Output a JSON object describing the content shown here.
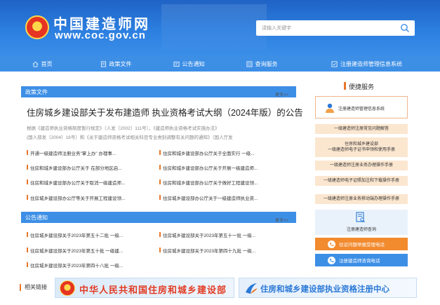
{
  "header": {
    "title": "中国建造师网",
    "url": "www.coc.gov.cn",
    "search_placeholder": "请输入关键字"
  },
  "nav": {
    "items": [
      {
        "label": "首页",
        "icon": "home-icon"
      },
      {
        "label": "政策文件",
        "icon": "document-icon"
      },
      {
        "label": "公告通知",
        "icon": "notice-icon"
      },
      {
        "label": "查询服务",
        "icon": "query-icon"
      },
      {
        "label": "注册建造师管理信息系统",
        "icon": "system-icon"
      }
    ]
  },
  "policy": {
    "section_title": "政策文件",
    "more": "更多>>",
    "headline": "住房城乡建设部关于发布建造师 执业资格考试大纲（2024年版）的公告",
    "summary_line1": "根据《建造师执业资格制度暂行规定》（人发〔2002〕111号），《建造师执业资格考试实施办法》",
    "summary_line2": "(国人部发〔2004〕16号）和《关于建造师资格考试相关科目专业类别调整有关问题的通知》（国人厅发",
    "items": [
      "开通一级建造师注册业务\"掌上办\" 办理事...",
      "住房和城乡建设部办公厅关于全面实行 一级...",
      "住房和城乡建设部办公厅关于 在部分地区启...",
      "住房和城乡建设部办公厅关于开展一级建造师...",
      "住房和城乡建设部办公厅关于取消一级建造师...",
      "住房和城乡建设部办公厅关于做好工程建设领...",
      "住房城乡建设部办公厅等关于开展工程建设领...",
      "住房城乡建设部办公厅关于一级建造师执业资..."
    ]
  },
  "notices": {
    "section_title": "公告通知",
    "more": "更多>>",
    "items": [
      "住房城乡建设部关于2023年第五十二批 一级...",
      "住房城乡建设部关于2023年第五十一批 一级...",
      "住房城乡建设部关于2023年第五十批 一级建...",
      "住房城乡建设部关于2023年第四十九批 一级...",
      "住房城乡建设部关于2023年第四十八批 一级..."
    ]
  },
  "sidebar": {
    "title": "便捷服务",
    "main_link": "注册建造师管理信息系统",
    "buttons": [
      "一级建造师注册常见问题解答",
      "住房和城乡建设部\n一级建造师电子证书申领和使用手册",
      "一级建造师注册业务办理操作手册",
      "一级建造师电子证照加注和下载操作手册",
      "一级建造师注册业务移动端办理操作手册"
    ],
    "query_tile": "注册建造师查询",
    "complaint": "住证问题举报受理电话",
    "consult": "注册建造师咨询电话"
  },
  "related": {
    "label": "相关链接",
    "banner1": "中华人民共和国住房和城乡建设部",
    "banner2": "住房和城乡建设部执业资格注册中心"
  },
  "colors": {
    "header_blue": "#2c7fe0",
    "nav_blue": "#3d8fe6",
    "accent_orange": "#e8762a",
    "banner_red": "#e23c24"
  }
}
